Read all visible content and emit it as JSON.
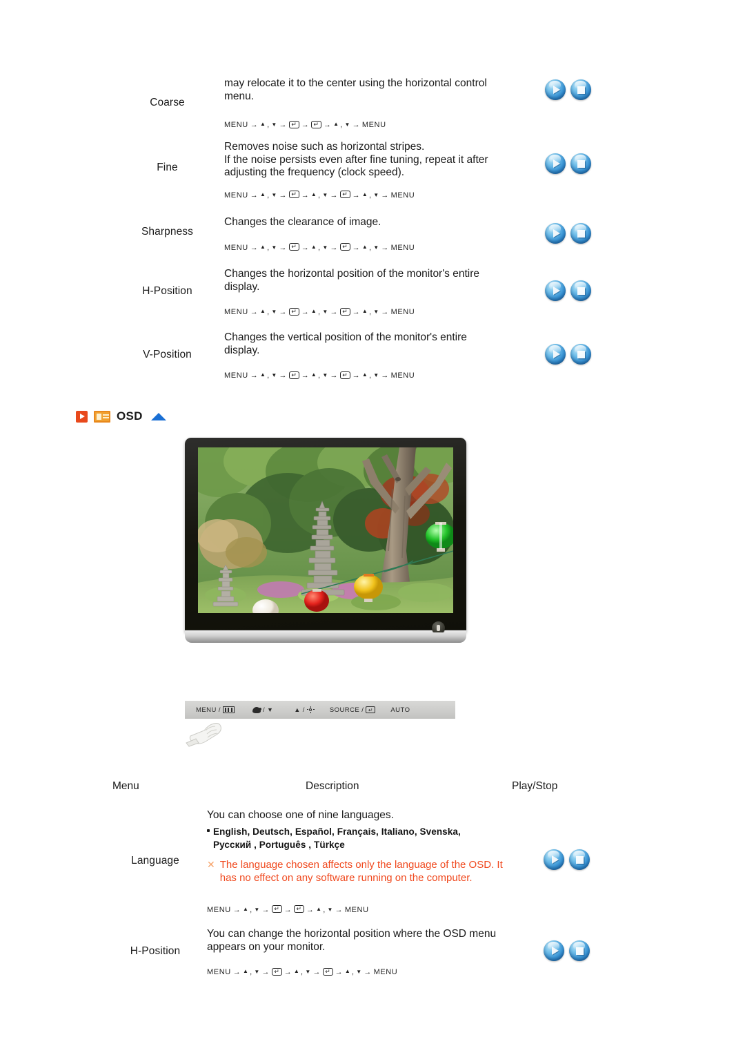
{
  "sections": {
    "picture_rows": [
      {
        "menu": "Coarse",
        "desc_lines": [
          "may relocate it to the center using the horizontal control",
          "menu."
        ],
        "sequence": [
          "MENU",
          "UPDOWN",
          "ENTER",
          "ENTER",
          "UPDOWN",
          "MENU"
        ]
      },
      {
        "menu": "Fine",
        "desc_lines": [
          "Removes noise such as horizontal stripes.",
          "If the noise persists even after fine tuning, repeat it after",
          "adjusting the frequency (clock speed)."
        ],
        "sequence": [
          "MENU",
          "UPDOWN",
          "ENTER",
          "UPDOWN",
          "ENTER",
          "UPDOWN",
          "MENU"
        ]
      },
      {
        "menu": "Sharpness",
        "desc_lines": [
          "Changes the clearance of image."
        ],
        "sequence": [
          "MENU",
          "UPDOWN",
          "ENTER",
          "UPDOWN",
          "ENTER",
          "UPDOWN",
          "MENU"
        ]
      },
      {
        "menu": "H-Position",
        "desc_lines": [
          "Changes the horizontal position of the monitor's entire",
          "display."
        ],
        "sequence": [
          "MENU",
          "UPDOWN",
          "ENTER",
          "UPDOWN",
          "ENTER",
          "UPDOWN",
          "MENU"
        ]
      },
      {
        "menu": "V-Position",
        "desc_lines": [
          "Changes the vertical position of the monitor's entire",
          "display."
        ],
        "sequence": [
          "MENU",
          "UPDOWN",
          "ENTER",
          "UPDOWN",
          "ENTER",
          "UPDOWN",
          "MENU"
        ]
      }
    ],
    "osd_header": {
      "label": "OSD",
      "play_icon": "play-square-icon",
      "osd_icon": "osd-panel-icon",
      "up_icon": "up-triangle-icon",
      "accent_orange": "#e8491c",
      "accent_blue": "#1a6fd4"
    },
    "monitor": {
      "alt": "LCD monitor displaying a garden photo with stone pagodas and paper lanterns",
      "power_button": "power-button"
    },
    "control_strip": {
      "items": [
        {
          "label": "MENU /",
          "icon": "menu-bars-icon"
        },
        {
          "label": "/",
          "icon": "contrast-icon",
          "icon2": "down-triangle-icon"
        },
        {
          "label": "/",
          "icon": "up-triangle-icon",
          "icon2": "brightness-sun-icon"
        },
        {
          "label": "SOURCE /",
          "icon": "enter-key-icon"
        },
        {
          "label": "AUTO",
          "icon": ""
        }
      ]
    },
    "table_header": {
      "menu": "Menu",
      "description": "Description",
      "play_stop": "Play/Stop"
    },
    "osd_rows": [
      {
        "menu": "Language",
        "desc_lines": [
          "You can choose one of nine languages."
        ],
        "bullet_lines": [
          "English, Deutsch, Español, Français,  Italiano, Svenska,",
          "Русский , Português , Türkçe"
        ],
        "warning_lines": [
          "The language chosen affects only the language of the OSD. It",
          "has no effect on any software running on the computer."
        ],
        "warning_color": "#f0481d",
        "sequence": [
          "MENU",
          "UPDOWN",
          "ENTER",
          "ENTER",
          "UPDOWN",
          "MENU"
        ]
      },
      {
        "menu": "H-Position",
        "desc_lines": [
          "You can change the horizontal position where the OSD menu",
          "appears on your monitor."
        ],
        "sequence": [
          "MENU",
          "UPDOWN",
          "ENTER",
          "UPDOWN",
          "ENTER",
          "UPDOWN",
          "MENU"
        ]
      }
    ],
    "buttons": {
      "play_label": "play-button",
      "stop_label": "stop-button"
    }
  }
}
